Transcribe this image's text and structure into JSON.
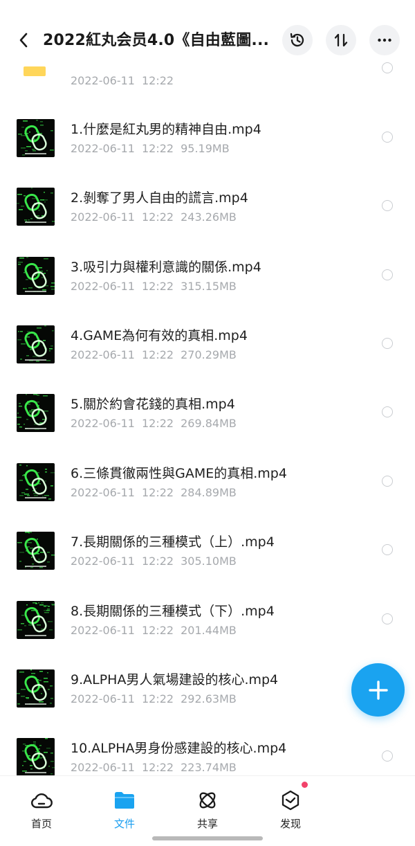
{
  "header": {
    "title": "2022紅丸会员4.0《自由藍圖...",
    "back_icon": "chevron-left-icon",
    "history_icon": "history-icon",
    "sort_icon": "sort-icon",
    "more_icon": "more-dots-icon"
  },
  "folder_row": {
    "date": "2022-06-11",
    "time": "12:22"
  },
  "files": [
    {
      "name": "1.什麼是紅丸男的精神自由.mp4",
      "date": "2022-06-11",
      "time": "12:22",
      "size": "95.19MB"
    },
    {
      "name": "2.剝奪了男人自由的謊言.mp4",
      "date": "2022-06-11",
      "time": "12:22",
      "size": "243.26MB"
    },
    {
      "name": "3.吸引力與權利意識的關係.mp4",
      "date": "2022-06-11",
      "time": "12:22",
      "size": "315.15MB"
    },
    {
      "name": "4.GAME為何有效的真相.mp4",
      "date": "2022-06-11",
      "time": "12:22",
      "size": "270.29MB"
    },
    {
      "name": "5.關於約會花錢的真相.mp4",
      "date": "2022-06-11",
      "time": "12:22",
      "size": "269.84MB"
    },
    {
      "name": "6.三條貫徹兩性與GAME的真相.mp4",
      "date": "2022-06-11",
      "time": "12:22",
      "size": "284.89MB"
    },
    {
      "name": "7.長期關係的三種模式（上）.mp4",
      "date": "2022-06-11",
      "time": "12:22",
      "size": "305.10MB"
    },
    {
      "name": "8.長期關係的三種模式（下）.mp4",
      "date": "2022-06-11",
      "time": "12:22",
      "size": "201.44MB"
    },
    {
      "name": "9.ALPHA男人氣場建設的核心.mp4",
      "date": "2022-06-11",
      "time": "12:22",
      "size": "292.63MB"
    },
    {
      "name": "10.ALPHA男身份感建設的核心.mp4",
      "date": "2022-06-11",
      "time": "12:22",
      "size": "223.74MB"
    }
  ],
  "fab": {
    "icon": "plus-icon"
  },
  "tabs": [
    {
      "label": "首页",
      "icon": "cloud-icon",
      "active": false
    },
    {
      "label": "文件",
      "icon": "folder-icon",
      "active": true
    },
    {
      "label": "共享",
      "icon": "share-orbit-icon",
      "active": false
    },
    {
      "label": "发现",
      "icon": "discover-icon",
      "active": false
    }
  ],
  "colors": {
    "accent": "#1aa3f0",
    "badge": "#f2426a",
    "thumb_green": "#39e64a",
    "meta_text": "#a6a9ad"
  }
}
